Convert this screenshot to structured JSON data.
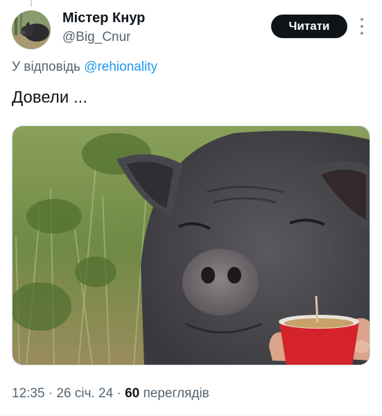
{
  "author": {
    "display_name": "Містер Кнур",
    "handle": "@Big_Cnur",
    "avatar_icon": "pig-avatar"
  },
  "actions": {
    "follow_label": "Читати",
    "more_icon": "more-dots-vertical"
  },
  "reply": {
    "prefix": "У відповідь",
    "mention": "@rehionality"
  },
  "tweet": {
    "text": "Довели ..."
  },
  "media": {
    "icon": "photo-pig-with-cup"
  },
  "meta": {
    "time": "12:35",
    "sep1": " · ",
    "date": "26 січ. 24",
    "sep2": " · ",
    "views_count": "60",
    "views_label": "переглядів"
  },
  "colors": {
    "text_primary": "#0f1419",
    "text_secondary": "#536471",
    "link": "#1d9bf0",
    "button_bg": "#0f1419",
    "button_text": "#ffffff"
  }
}
